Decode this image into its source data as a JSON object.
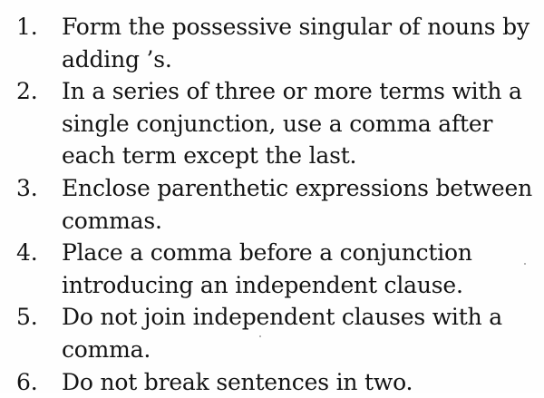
{
  "rules": [
    {
      "number": "1.",
      "text": "Form the possessive singular of nouns by adding ’s."
    },
    {
      "number": "2.",
      "text": "In a series of three or more terms with a single conjunction, use a comma after each term except the last."
    },
    {
      "number": "3.",
      "text": "Enclose parenthetic expressions between commas."
    },
    {
      "number": "4.",
      "text": "Place a comma before a conjunction introducing an independent clause."
    },
    {
      "number": "5.",
      "text": "Do not join independent clauses with a comma."
    },
    {
      "number": "6.",
      "text": "Do not break sentences in two."
    }
  ]
}
